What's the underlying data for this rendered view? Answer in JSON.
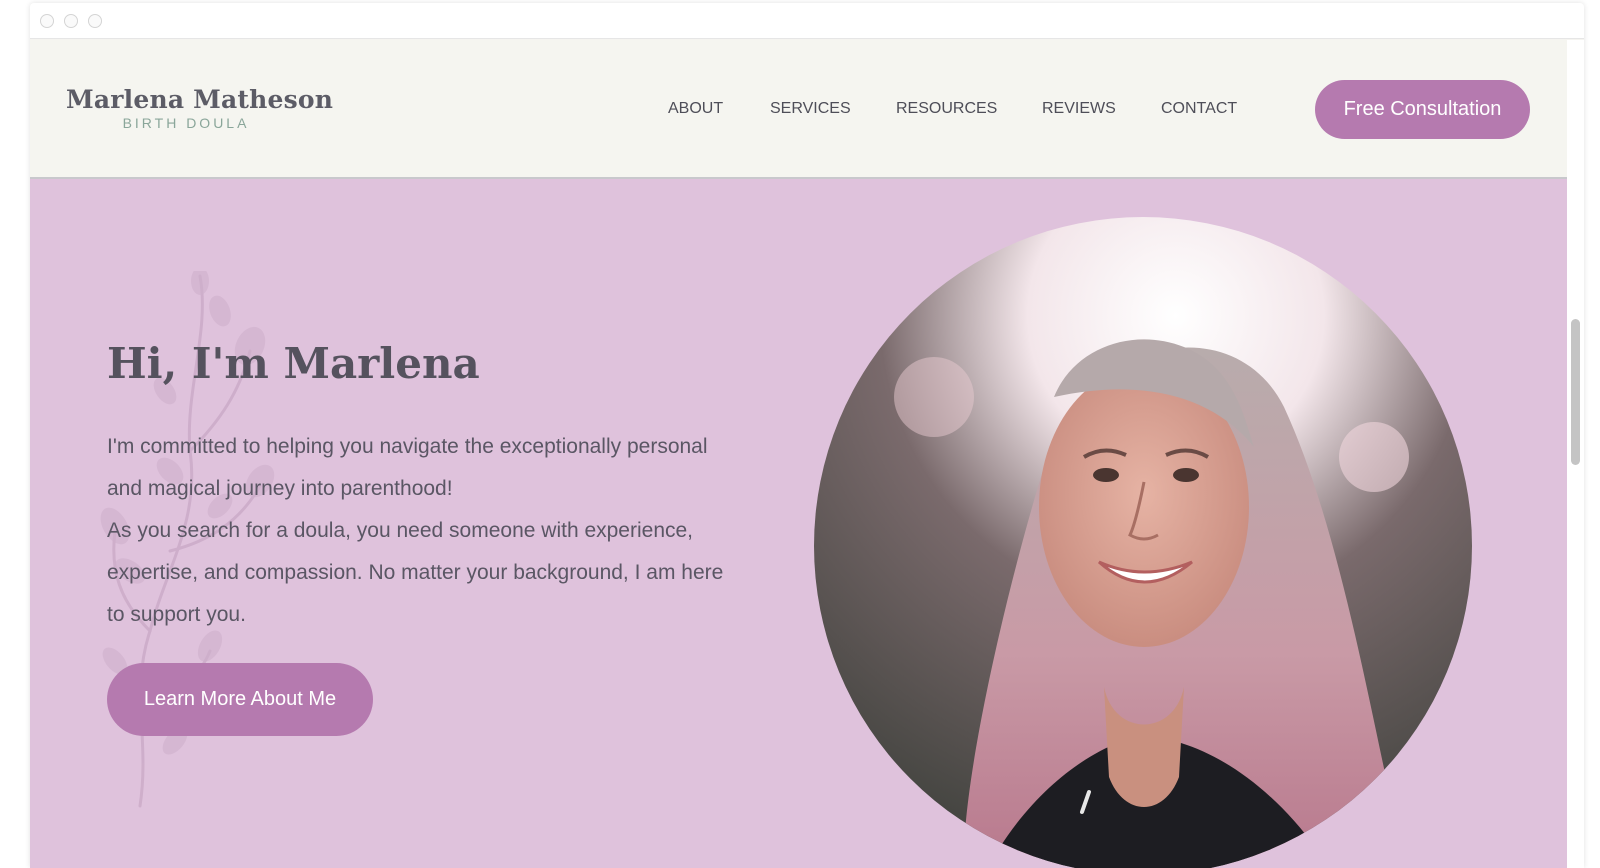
{
  "site": {
    "logo_name": "Marlena Matheson",
    "logo_subtitle": "BIRTH DOULA"
  },
  "nav": {
    "items": [
      {
        "label": "ABOUT"
      },
      {
        "label": "SERVICES"
      },
      {
        "label": "RESOURCES"
      },
      {
        "label": "REVIEWS"
      },
      {
        "label": "CONTACT"
      }
    ],
    "cta_label": "Free Consultation"
  },
  "hero": {
    "title": "Hi, I'm Marlena",
    "paragraph_1": "I'm committed to helping you navigate the exceptionally personal and magical journey into parenthood!",
    "paragraph_2": "As you search for a doula, you need someone with experience, expertise, and compassion. No matter your background, I am here to support you.",
    "cta_label": "Learn More About Me"
  },
  "colors": {
    "accent": "#b57aaf",
    "hero_background": "#dfc2dc",
    "header_background": "#f5f5f0",
    "text": "#55525e",
    "logo_subtitle": "#8aa69a"
  }
}
